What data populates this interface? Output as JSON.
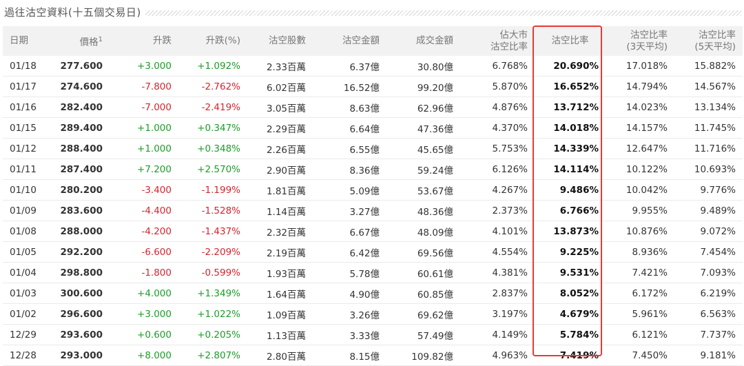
{
  "section_title": "過往沽空資料(十五個交易日)",
  "headers": {
    "date": "日期",
    "price": "價格",
    "price_sup": "1",
    "change": "升跌",
    "change_pct": "升跌(%)",
    "short_shares": "沽空股數",
    "short_amount": "沽空金額",
    "turnover": "成交金額",
    "market_ratio_l1": "佔大市",
    "market_ratio_l2": "沽空比率",
    "short_ratio": "沽空比率",
    "avg3_l1": "沽空比率",
    "avg3_l2": "(3天平均)",
    "avg5_l1": "沽空比率",
    "avg5_l2": "(5天平均)"
  },
  "highlight_color": "#e53935",
  "up_color": "#1a9d28",
  "down_color": "#d9232d",
  "rows": [
    {
      "date": "01/18",
      "price": "277.600",
      "change": "+3.000",
      "change_pct": "+1.092%",
      "direction": "up",
      "short_shares": "2.33百萬",
      "short_amount": "6.37億",
      "turnover": "30.80億",
      "market_ratio": "6.768%",
      "short_ratio": "20.690%",
      "avg3": "17.018%",
      "avg5": "15.882%"
    },
    {
      "date": "01/17",
      "price": "274.600",
      "change": "-7.800",
      "change_pct": "-2.762%",
      "direction": "down",
      "short_shares": "6.02百萬",
      "short_amount": "16.52億",
      "turnover": "99.20億",
      "market_ratio": "5.870%",
      "short_ratio": "16.652%",
      "avg3": "14.794%",
      "avg5": "14.567%"
    },
    {
      "date": "01/16",
      "price": "282.400",
      "change": "-7.000",
      "change_pct": "-2.419%",
      "direction": "down",
      "short_shares": "3.05百萬",
      "short_amount": "8.63億",
      "turnover": "62.96億",
      "market_ratio": "4.876%",
      "short_ratio": "13.712%",
      "avg3": "14.023%",
      "avg5": "13.134%"
    },
    {
      "date": "01/15",
      "price": "289.400",
      "change": "+1.000",
      "change_pct": "+0.347%",
      "direction": "up",
      "short_shares": "2.29百萬",
      "short_amount": "6.64億",
      "turnover": "47.36億",
      "market_ratio": "4.370%",
      "short_ratio": "14.018%",
      "avg3": "14.157%",
      "avg5": "11.745%"
    },
    {
      "date": "01/12",
      "price": "288.400",
      "change": "+1.000",
      "change_pct": "+0.348%",
      "direction": "up",
      "short_shares": "2.26百萬",
      "short_amount": "6.55億",
      "turnover": "45.65億",
      "market_ratio": "5.753%",
      "short_ratio": "14.339%",
      "avg3": "12.647%",
      "avg5": "11.716%"
    },
    {
      "date": "01/11",
      "price": "287.400",
      "change": "+7.200",
      "change_pct": "+2.570%",
      "direction": "up",
      "short_shares": "2.90百萬",
      "short_amount": "8.36億",
      "turnover": "59.24億",
      "market_ratio": "6.126%",
      "short_ratio": "14.114%",
      "avg3": "10.122%",
      "avg5": "10.693%"
    },
    {
      "date": "01/10",
      "price": "280.200",
      "change": "-3.400",
      "change_pct": "-1.199%",
      "direction": "down",
      "short_shares": "1.81百萬",
      "short_amount": "5.09億",
      "turnover": "53.67億",
      "market_ratio": "4.267%",
      "short_ratio": "9.486%",
      "avg3": "10.042%",
      "avg5": "9.776%"
    },
    {
      "date": "01/09",
      "price": "283.600",
      "change": "-4.400",
      "change_pct": "-1.528%",
      "direction": "down",
      "short_shares": "1.14百萬",
      "short_amount": "3.27億",
      "turnover": "48.36億",
      "market_ratio": "2.373%",
      "short_ratio": "6.766%",
      "avg3": "9.955%",
      "avg5": "9.489%"
    },
    {
      "date": "01/08",
      "price": "288.000",
      "change": "-4.200",
      "change_pct": "-1.437%",
      "direction": "down",
      "short_shares": "2.32百萬",
      "short_amount": "6.67億",
      "turnover": "48.09億",
      "market_ratio": "4.101%",
      "short_ratio": "13.873%",
      "avg3": "10.876%",
      "avg5": "9.072%"
    },
    {
      "date": "01/05",
      "price": "292.200",
      "change": "-6.600",
      "change_pct": "-2.209%",
      "direction": "down",
      "short_shares": "2.19百萬",
      "short_amount": "6.42億",
      "turnover": "69.56億",
      "market_ratio": "4.554%",
      "short_ratio": "9.225%",
      "avg3": "8.936%",
      "avg5": "7.454%"
    },
    {
      "date": "01/04",
      "price": "298.800",
      "change": "-1.800",
      "change_pct": "-0.599%",
      "direction": "down",
      "short_shares": "1.93百萬",
      "short_amount": "5.78億",
      "turnover": "60.61億",
      "market_ratio": "4.381%",
      "short_ratio": "9.531%",
      "avg3": "7.421%",
      "avg5": "7.093%"
    },
    {
      "date": "01/03",
      "price": "300.600",
      "change": "+4.000",
      "change_pct": "+1.349%",
      "direction": "up",
      "short_shares": "1.64百萬",
      "short_amount": "4.90億",
      "turnover": "60.85億",
      "market_ratio": "2.837%",
      "short_ratio": "8.052%",
      "avg3": "6.172%",
      "avg5": "6.219%"
    },
    {
      "date": "01/02",
      "price": "296.600",
      "change": "+3.000",
      "change_pct": "+1.022%",
      "direction": "up",
      "short_shares": "1.09百萬",
      "short_amount": "3.26億",
      "turnover": "69.62億",
      "market_ratio": "3.197%",
      "short_ratio": "4.679%",
      "avg3": "5.961%",
      "avg5": "6.563%"
    },
    {
      "date": "12/29",
      "price": "293.600",
      "change": "+0.600",
      "change_pct": "+0.205%",
      "direction": "up",
      "short_shares": "1.13百萬",
      "short_amount": "3.33億",
      "turnover": "57.49億",
      "market_ratio": "4.149%",
      "short_ratio": "5.784%",
      "avg3": "6.121%",
      "avg5": "7.737%"
    },
    {
      "date": "12/28",
      "price": "293.000",
      "change": "+8.000",
      "change_pct": "+2.807%",
      "direction": "up",
      "short_shares": "2.80百萬",
      "short_amount": "8.15億",
      "turnover": "109.82億",
      "market_ratio": "4.963%",
      "short_ratio": "7.419%",
      "avg3": "7.450%",
      "avg5": "9.181%"
    }
  ]
}
